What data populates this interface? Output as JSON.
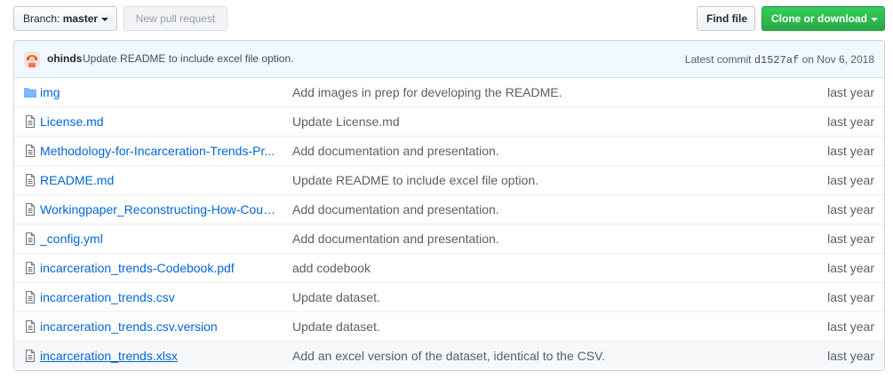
{
  "toolbar": {
    "branch_prefix": "Branch: ",
    "branch_name": "master",
    "new_pull_request": "New pull request",
    "find_file": "Find file",
    "clone_or_download": "Clone or download"
  },
  "commit": {
    "author": "ohinds",
    "message": "Update README to include excel file option.",
    "latest_label": "Latest commit",
    "sha": "d1527af",
    "date": "on Nov 6, 2018"
  },
  "files": [
    {
      "type": "folder",
      "icon": "folder-icon",
      "name": "img",
      "message": "Add images in prep for developing the README.",
      "age": "last year"
    },
    {
      "type": "file",
      "icon": "file-icon",
      "name": "License.md",
      "message": "Update License.md",
      "age": "last year"
    },
    {
      "type": "file",
      "icon": "file-icon",
      "name": "Methodology-for-Incarceration-Trends-Pr...",
      "message": "Add documentation and presentation.",
      "age": "last year"
    },
    {
      "type": "file",
      "icon": "file-icon",
      "name": "README.md",
      "message": "Update README to include excel file option.",
      "age": "last year"
    },
    {
      "type": "file",
      "icon": "file-icon",
      "name": "Workingpaper_Reconstructing-How-Coun...",
      "message": "Add documentation and presentation.",
      "age": "last year"
    },
    {
      "type": "file",
      "icon": "file-icon",
      "name": "_config.yml",
      "message": "Add documentation and presentation.",
      "age": "last year"
    },
    {
      "type": "file",
      "icon": "file-icon",
      "name": "incarceration_trends-Codebook.pdf",
      "message": "add codebook",
      "age": "last year"
    },
    {
      "type": "file",
      "icon": "file-icon",
      "name": "incarceration_trends.csv",
      "message": "Update dataset.",
      "age": "last year"
    },
    {
      "type": "file",
      "icon": "file-icon",
      "name": "incarceration_trends.csv.version",
      "message": "Update dataset.",
      "age": "last year"
    },
    {
      "type": "file",
      "icon": "file-icon",
      "name": "incarceration_trends.xlsx",
      "message": "Add an excel version of the dataset, identical to the CSV.",
      "age": "last year"
    }
  ],
  "colors": {
    "link": "#0366d6",
    "clone_button": "#28a745",
    "commit_bar": "#f1f8ff",
    "folder_icon": "#79b8ff"
  }
}
